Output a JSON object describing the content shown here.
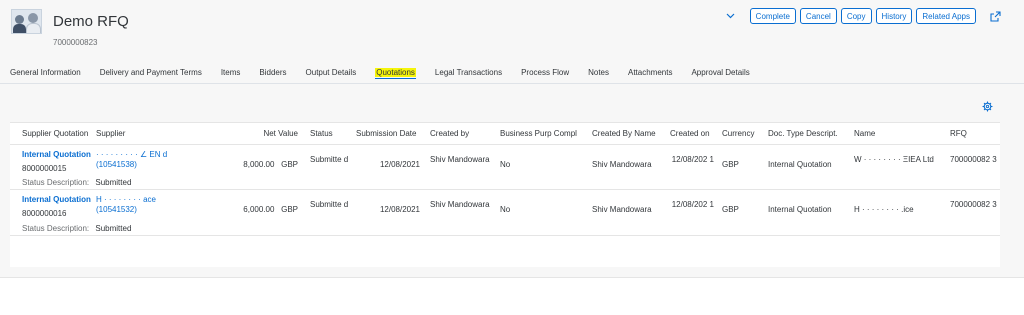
{
  "header": {
    "title": "Demo RFQ",
    "subtitle": "7000000823",
    "actions": {
      "complete": "Complete",
      "cancel": "Cancel",
      "copy": "Copy",
      "history": "History",
      "related_apps": "Related Apps"
    }
  },
  "tabs": [
    "General Information",
    "Delivery and Payment Terms",
    "Items",
    "Bidders",
    "Output Details",
    "Quotations",
    "Legal Transactions",
    "Process Flow",
    "Notes",
    "Attachments",
    "Approval Details"
  ],
  "active_tab": "Quotations",
  "table": {
    "columns": [
      "Supplier Quotation",
      "Supplier",
      "Net Value",
      "Status",
      "Submission Date",
      "Created by",
      "Business Purp Compl",
      "Created By Name",
      "Created on",
      "Currency",
      "Doc. Type Descript.",
      "Name",
      "RFQ"
    ],
    "status_description_label": "Status Description:",
    "rows": [
      {
        "quotation_link": "Internal Quotation",
        "quotation_number": "8000000015",
        "supplier_top": "·  · · · · · · · ·  ∠ ΕΝ   d",
        "supplier_id": "(10541538)",
        "net_value": "8,000.00",
        "net_currency": "GBP",
        "status": "Submitte d",
        "submission_date": "12/08/2021",
        "created_by": "Shiv Mandowara",
        "business_purp": "No",
        "created_by_name": "Shiv Mandowara",
        "created_on": "12/08/202 1",
        "currency": "GBP",
        "doc_type": "Internal Quotation",
        "name": "W · · · · · · · · ΞΙΕΑ Ltd",
        "rfq": "700000082 3",
        "status_description": "Submitted"
      },
      {
        "quotation_link": "Internal Quotation",
        "quotation_number": "8000000016",
        "supplier_top": "Η · · · · · · · · ace",
        "supplier_id": "(10541532)",
        "net_value": "6,000.00",
        "net_currency": "GBP",
        "status": "Submitte d",
        "submission_date": "12/08/2021",
        "created_by": "Shiv Mandowara",
        "business_purp": "No",
        "created_by_name": "Shiv Mandowara",
        "created_on": "12/08/202 1",
        "currency": "GBP",
        "doc_type": "Internal Quotation",
        "name": "H · · · · · · · · .ice",
        "rfq": "700000082 3",
        "status_description": "Submitted"
      }
    ]
  },
  "colors": {
    "accent": "#0a6ed1",
    "highlight": "#f5f50a",
    "background": "#f7f7f7"
  },
  "icons": {
    "avatar": "rfq-avatar-image",
    "chevron": "chevron-down-icon",
    "share": "share-icon",
    "settings": "gear-icon"
  }
}
